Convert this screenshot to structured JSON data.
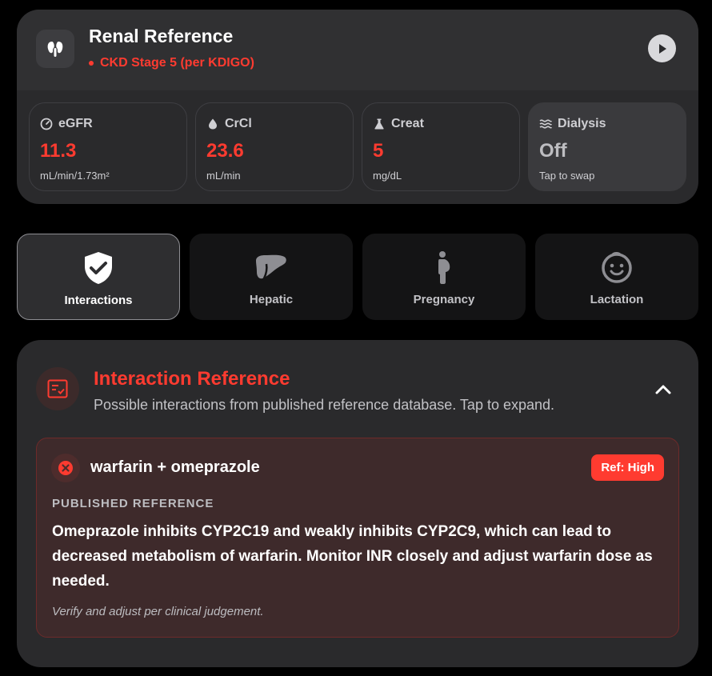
{
  "header": {
    "title": "Renal Reference",
    "stage": "CKD Stage 5 (per KDIGO)",
    "icon": "kidney-icon",
    "action_icon": "play-icon"
  },
  "metrics": [
    {
      "label": "eGFR",
      "value": "11.3",
      "unit": "mL/min/1.73m²",
      "icon": "gauge-icon"
    },
    {
      "label": "CrCl",
      "value": "23.6",
      "unit": "mL/min",
      "icon": "drop-icon"
    },
    {
      "label": "Creat",
      "value": "5",
      "unit": "mg/dL",
      "icon": "flask-icon"
    },
    {
      "label": "Dialysis",
      "value": "Off",
      "unit": "Tap to swap",
      "icon": "waves-icon"
    }
  ],
  "tabs": [
    {
      "label": "Interactions",
      "icon": "shield-check-icon",
      "active": true
    },
    {
      "label": "Hepatic",
      "icon": "liver-icon",
      "active": false
    },
    {
      "label": "Pregnancy",
      "icon": "pregnant-icon",
      "active": false
    },
    {
      "label": "Lactation",
      "icon": "baby-face-icon",
      "active": false
    }
  ],
  "interaction_reference": {
    "title": "Interaction Reference",
    "subtitle": "Possible interactions from published reference database. Tap to expand.",
    "item": {
      "drugs": "warfarin + omeprazole",
      "badge": "Ref: High",
      "section_label": "PUBLISHED REFERENCE",
      "description": "Omeprazole inhibits CYP2C19 and weakly inhibits CYP2C9, which can lead to decreased metabolism of warfarin. Monitor INR closely and adjust warfarin dose as needed.",
      "note": "Verify and adjust per clinical judgement."
    }
  },
  "colors": {
    "accent_red": "#ff3b30",
    "card_bg": "#2a2a2c",
    "background": "#000000"
  }
}
